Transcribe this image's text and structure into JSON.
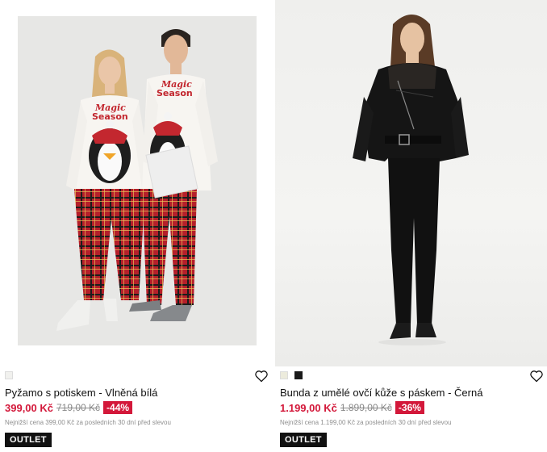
{
  "products": [
    {
      "name": "Pyžamo s potiskem - Vlněná bílá",
      "price_now": "399,00 Kč",
      "price_old": "719,00 Kč",
      "discount": "-44%",
      "lowest_price_note": "Nejnižší cena 399,00 Kč za posledních 30 dní před slevou",
      "badge": "OUTLET",
      "print_text_line1": "Magic",
      "print_text_line2": "Season",
      "swatch_colors": [
        "#f1f1ee"
      ]
    },
    {
      "name": "Bunda z umělé ovčí kůže s páskem - Černá",
      "price_now": "1.199,00 Kč",
      "price_old": "1.899,00 Kč",
      "discount": "-36%",
      "lowest_price_note": "Nejnižší cena 1.199,00 Kč za posledních 30 dní před slevou",
      "badge": "OUTLET",
      "swatch_colors": [
        "#ecebdc",
        "#1a1a1a"
      ]
    }
  ],
  "colors": {
    "sale_red": "#d3183a",
    "badge_black": "#111111"
  },
  "icons": {
    "wishlist": "heart-outline-icon"
  }
}
